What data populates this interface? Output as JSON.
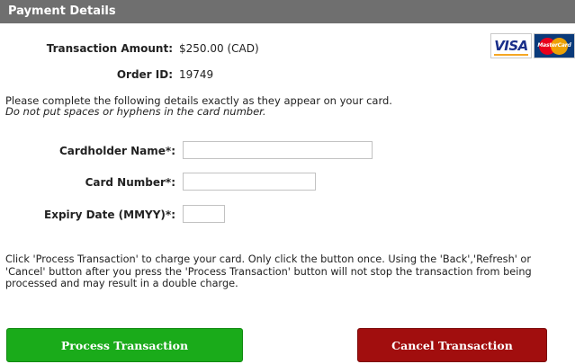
{
  "header": {
    "title": "Payment Details"
  },
  "summary": {
    "amount_label": "Transaction Amount:",
    "amount_value": "$250.00 (CAD)",
    "order_label": "Order ID:",
    "order_value": "19749"
  },
  "cards": {
    "visa_text": "VISA",
    "mastercard_text": "MasterCard",
    "visa_icon": "visa-logo",
    "mastercard_icon": "mastercard-logo"
  },
  "instructions": {
    "line1": "Please complete the following details exactly as they appear on your card.",
    "line2": "Do not put spaces or hyphens in the card number."
  },
  "form": {
    "cardholder_label": "Cardholder Name*:",
    "cardholder_value": "",
    "cardnumber_label": "Card Number*:",
    "cardnumber_value": "",
    "expiry_label": "Expiry Date (MMYY)*:",
    "expiry_value": ""
  },
  "warning": "Click 'Process Transaction' to charge your card. Only click the button once. Using the 'Back','Refresh' or 'Cancel' button after you press the 'Process Transaction' button will not stop the transaction from being processed and may result in a double charge.",
  "buttons": {
    "process_label": "Process Transaction",
    "cancel_label": "Cancel Transaction"
  },
  "colors": {
    "header": "#6f6f6f",
    "process": "#1aab1a",
    "cancel": "#a10e0e"
  }
}
